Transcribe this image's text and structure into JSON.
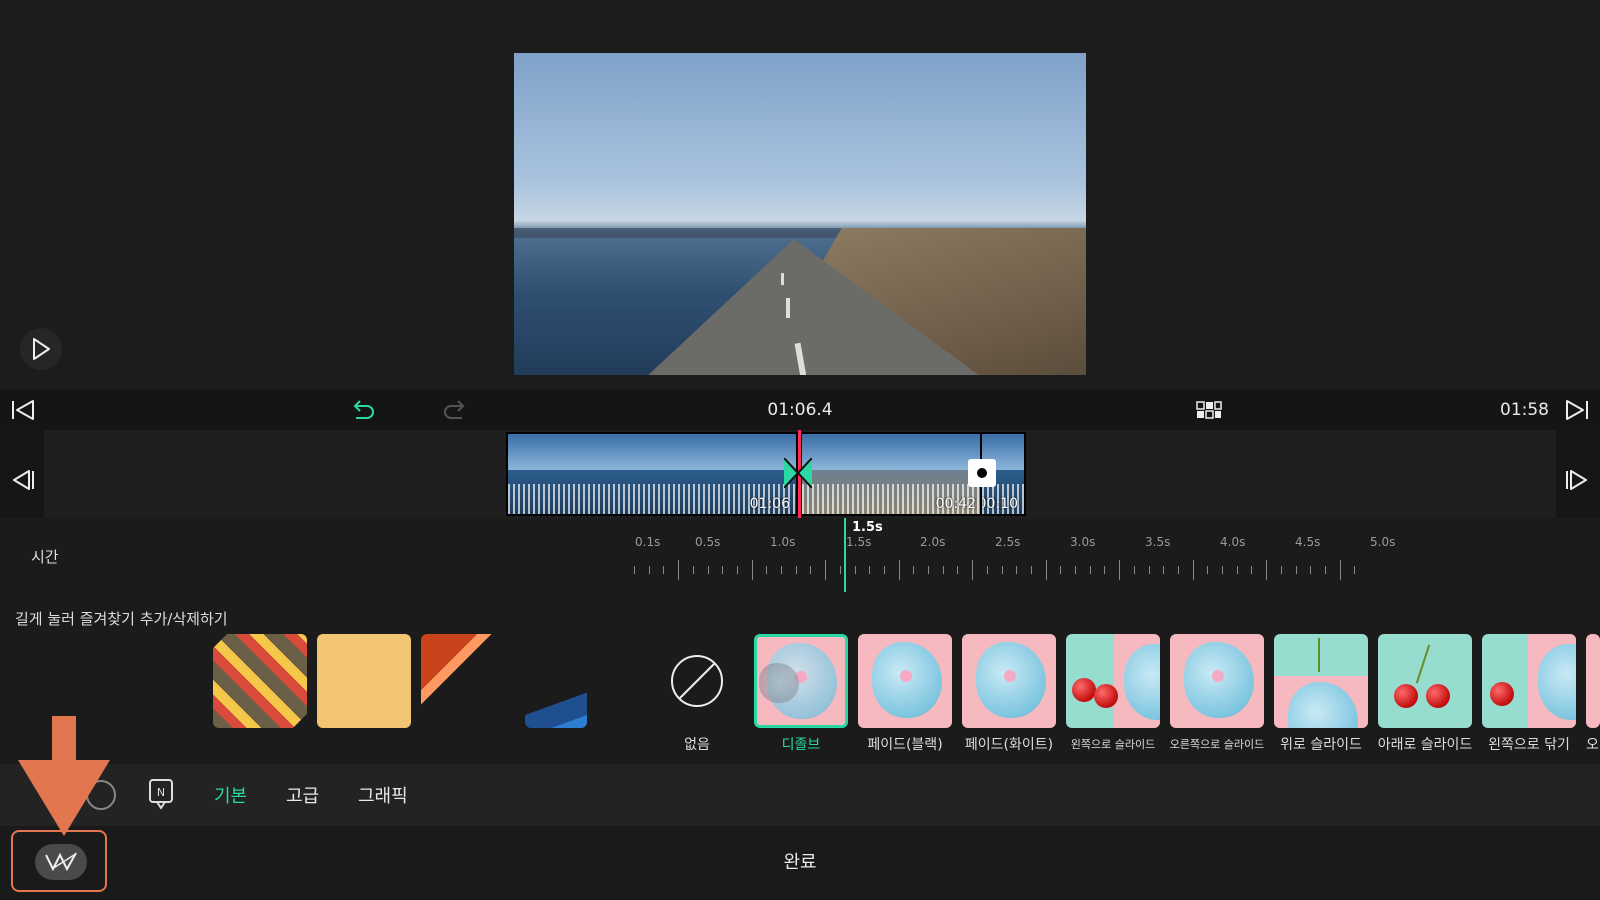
{
  "toolbar": {
    "current_time": "01:06.4",
    "end_time": "01:58"
  },
  "timeline": {
    "clips": [
      {
        "label": "01:06"
      },
      {
        "label": "00:42"
      },
      {
        "label": "00:10"
      }
    ]
  },
  "duration": {
    "label": "시간",
    "value": "1.5s",
    "ticks": [
      "0.1s",
      "0.5s",
      "1.0s",
      "1.5s",
      "2.0s",
      "2.5s",
      "3.0s",
      "3.5s",
      "4.0s",
      "4.5s",
      "5.0s"
    ]
  },
  "favorites_hint": "길게 눌러 즐겨찾기 추가/삭제하기",
  "transitions": [
    {
      "label": "없음"
    },
    {
      "label": "디졸브"
    },
    {
      "label": "페이드(블랙)"
    },
    {
      "label": "페이드(화이트)"
    },
    {
      "label": "왼쪽으로 슬라이드"
    },
    {
      "label": "오른쪽으로 슬라이드"
    },
    {
      "label": "위로 슬라이드"
    },
    {
      "label": "아래로 슬라이드"
    },
    {
      "label": "왼쪽으로 닦기"
    },
    {
      "label": "오"
    }
  ],
  "tabs": {
    "basic": "기본",
    "advanced": "고급",
    "graphic": "그래픽"
  },
  "footer": {
    "done": "완료"
  },
  "colors": {
    "accent": "#2ad8a3",
    "playhead": "#ff2d55",
    "annotation": "#e2764e"
  }
}
